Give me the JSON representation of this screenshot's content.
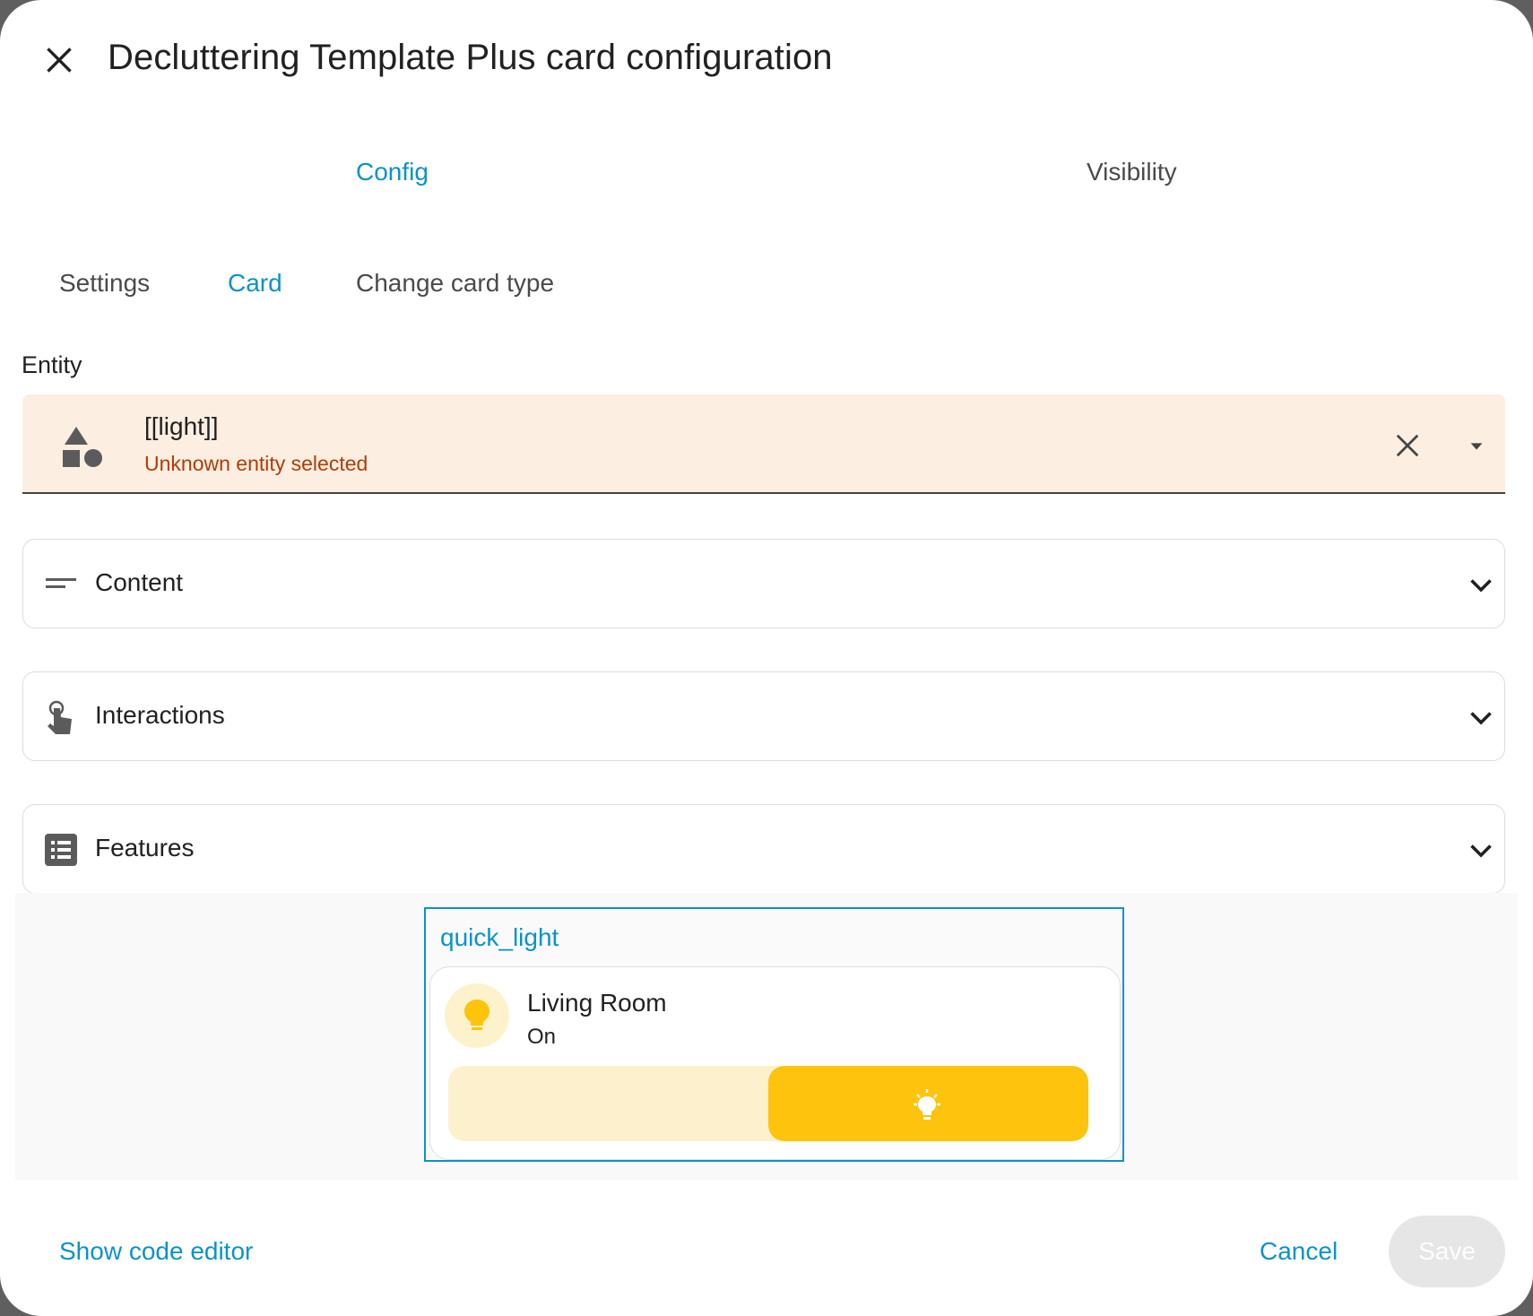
{
  "dialog": {
    "title": "Decluttering Template Plus card configuration",
    "close_icon": "close-icon"
  },
  "tabs_top": [
    {
      "label": "Config",
      "active": true
    },
    {
      "label": "Visibility",
      "active": false
    }
  ],
  "tabs_sub": [
    {
      "label": "Settings",
      "active": false
    },
    {
      "label": "Card",
      "active": true
    },
    {
      "label": "Change card type",
      "active": false
    }
  ],
  "entity": {
    "label": "Entity",
    "value": "[[light]]",
    "error": "Unknown entity selected",
    "icon": "shapes-icon"
  },
  "panels": [
    {
      "label": "Content",
      "icon": "text-short-icon"
    },
    {
      "label": "Interactions",
      "icon": "gesture-tap-icon"
    },
    {
      "label": "Features",
      "icon": "list-box-icon"
    }
  ],
  "preview": {
    "template_name": "quick_light",
    "tile": {
      "name": "Living Room",
      "state": "On",
      "brightness_level": 0.5
    }
  },
  "footer": {
    "code_editor": "Show code editor",
    "cancel": "Cancel",
    "save": "Save"
  },
  "colors": {
    "accent": "#0a93c8",
    "light_on": "#fec30c",
    "error_bg": "#fdeee2",
    "error_text": "#b23c06"
  }
}
